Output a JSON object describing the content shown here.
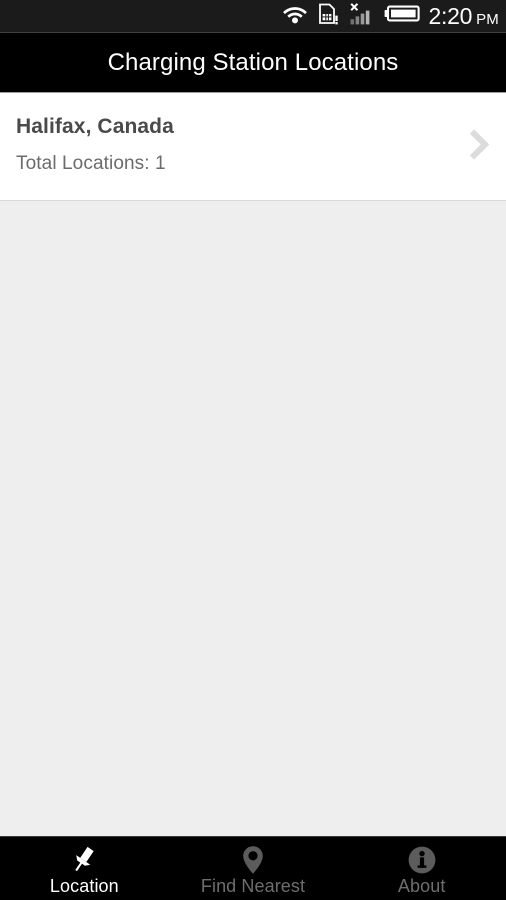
{
  "status_bar": {
    "time": "2:20",
    "ampm": "PM",
    "icons": [
      {
        "name": "wifi-icon",
        "label": "wifi"
      },
      {
        "name": "sim-card-alert-icon",
        "label": "sim card alert"
      },
      {
        "name": "signal-no-service-icon",
        "label": "no signal"
      },
      {
        "name": "battery-icon",
        "label": "battery"
      }
    ],
    "background": "#1b1b1b",
    "foreground": "#ffffff"
  },
  "header": {
    "title": "Charging Station Locations",
    "background": "#000000",
    "text_color": "#ffffff"
  },
  "list": {
    "items": [
      {
        "title": "Halifax, Canada",
        "subtitle": "Total Locations: 1",
        "chevron": "chevron-right-icon"
      }
    ]
  },
  "content": {
    "background": "#eeeeee"
  },
  "bottom_nav": {
    "active_color": "#ffffff",
    "inactive_color": "#6e6e6e",
    "background": "#000000",
    "tabs": [
      {
        "label": "Location",
        "icon": "pushpin-icon",
        "active": true
      },
      {
        "label": "Find Nearest",
        "icon": "map-pin-icon",
        "active": false
      },
      {
        "label": "About",
        "icon": "info-circle-icon",
        "active": false
      }
    ]
  }
}
